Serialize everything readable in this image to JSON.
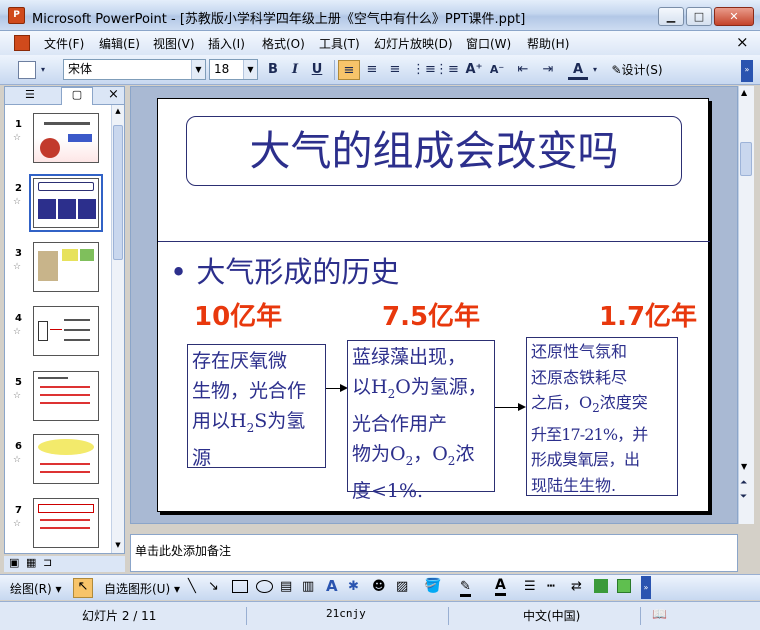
{
  "window": {
    "app_icon": "powerpoint-icon",
    "title": "Microsoft PowerPoint - [苏教版小学科学四年级上册《空气中有什么》PPT课件.ppt]",
    "buttons": {
      "minimize": "minimize-icon",
      "maximize": "maximize-icon",
      "close": "close-icon"
    }
  },
  "menu": {
    "items": [
      "文件(F)",
      "编辑(E)",
      "视图(V)",
      "插入(I)",
      "格式(O)",
      "工具(T)",
      "幻灯片放映(D)",
      "窗口(W)",
      "帮助(H)"
    ],
    "close_doc": "×"
  },
  "format_toolbar": {
    "font": "宋体",
    "size": "18",
    "bold": "B",
    "italic": "I",
    "underline": "U",
    "font_color": "A",
    "design": "设计(S)"
  },
  "slides_pane": {
    "tabs": [
      "outline-tab-icon",
      "slides-tab-icon"
    ],
    "close": "×",
    "selected_index": 2,
    "thumbnails": [
      {
        "num": "1"
      },
      {
        "num": "2"
      },
      {
        "num": "3"
      },
      {
        "num": "4"
      },
      {
        "num": "5"
      },
      {
        "num": "6"
      },
      {
        "num": "7"
      }
    ]
  },
  "slide": {
    "title": "大气的组成会改变吗",
    "bullet": "• 大气形成的历史",
    "years": [
      "10亿年",
      "7.5亿年",
      "1.7亿年"
    ],
    "box1_lines": [
      "存在厌氧微",
      "生物，光合作",
      "用以H",
      "2",
      "S为氢",
      "源"
    ],
    "box2_lines": [
      "蓝绿藻出现，",
      "以H",
      "2",
      "O为氢源，",
      "光合作用产",
      "物为O",
      "2",
      "，O",
      "2",
      "浓",
      "度<1%."
    ],
    "box3_lines": [
      "还原性气氛和",
      "还原态铁耗尽",
      "之后，O",
      "2",
      "浓度突",
      "升至17-21%，并",
      "形成臭氧层，出",
      "现陆生生物."
    ],
    "colors": {
      "title": "#2c2f8c",
      "year": "#e8380d",
      "box_text": "#2c2f8c"
    }
  },
  "notes": {
    "placeholder": "单击此处添加备注"
  },
  "draw_toolbar": {
    "draw": "绘图(R)",
    "autoshapes": "自选图形(U)"
  },
  "status": {
    "slide": "幻灯片 2 / 11",
    "template": "21cnjy",
    "language": "中文(中国)"
  }
}
